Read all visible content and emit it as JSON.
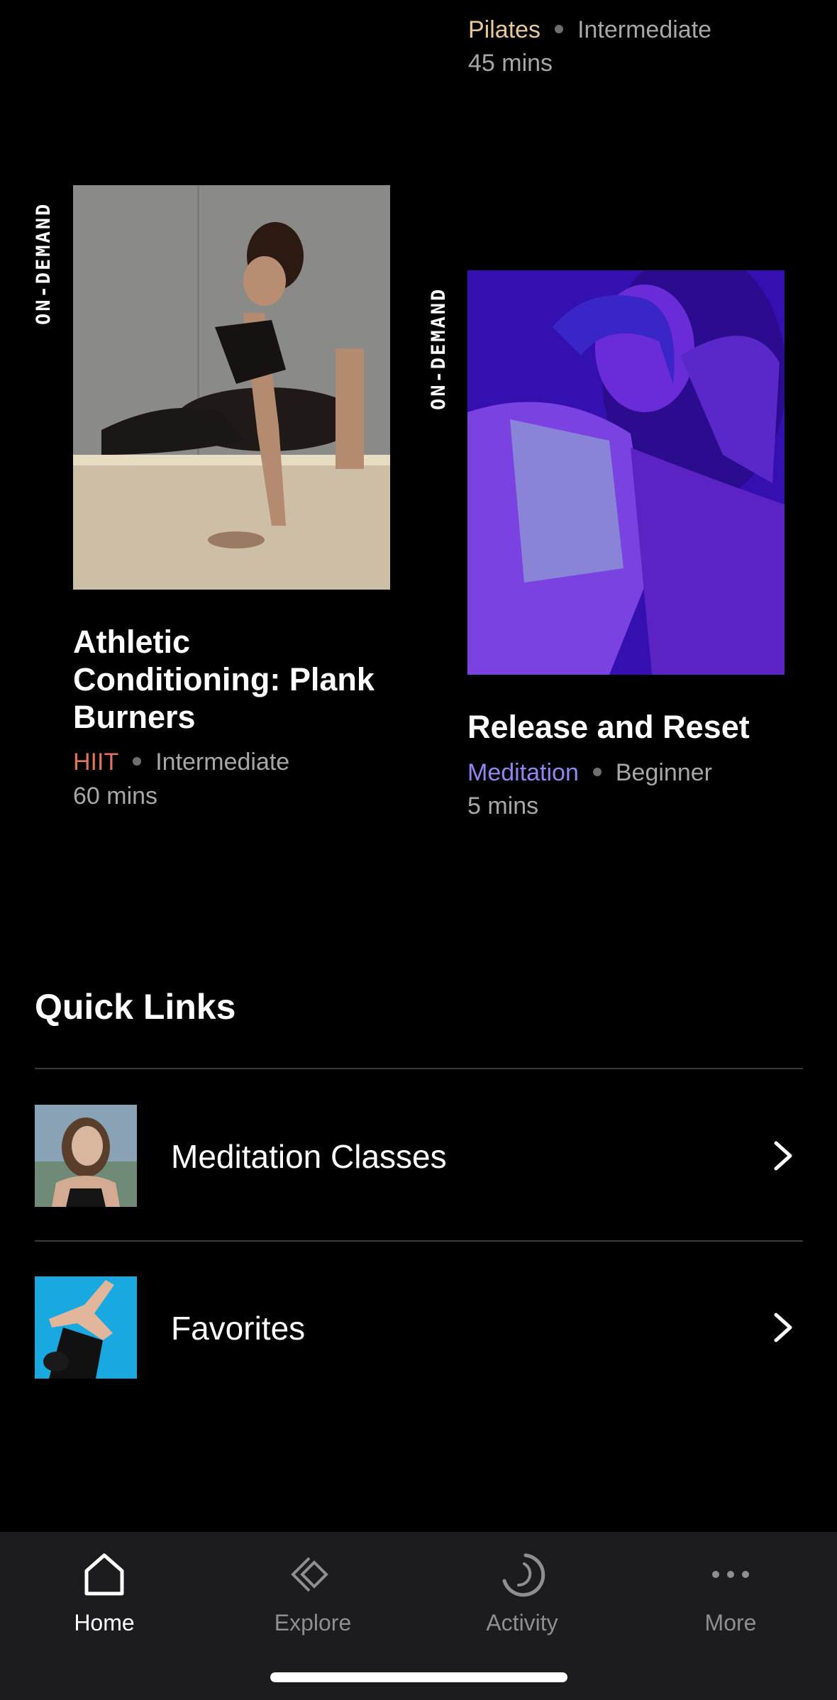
{
  "top_card": {
    "category": "Pilates",
    "level": "Intermediate",
    "duration": "45 mins",
    "category_color": "#e8c898"
  },
  "cards": [
    {
      "badge": "ON-DEMAND",
      "title_line1": "Athletic",
      "title_line2": "Conditioning: Plank",
      "title_line3": "Burners",
      "category": "HIIT",
      "level": "Intermediate",
      "duration": "60 mins",
      "category_color": "#e0735a"
    },
    {
      "badge": "ON-DEMAND",
      "title_line1": "Release and Reset",
      "category": "Meditation",
      "level": "Beginner",
      "duration": "5 mins",
      "category_color": "#8f86f0"
    }
  ],
  "quick_links": {
    "title": "Quick Links",
    "items": [
      {
        "label": "Meditation Classes"
      },
      {
        "label": "Favorites"
      }
    ]
  },
  "tabbar": {
    "tabs": [
      {
        "label": "Home",
        "icon": "home-icon",
        "active": true
      },
      {
        "label": "Explore",
        "icon": "explore-icon"
      },
      {
        "label": "Activity",
        "icon": "activity-icon"
      },
      {
        "label": "More",
        "icon": "more-icon"
      }
    ]
  }
}
